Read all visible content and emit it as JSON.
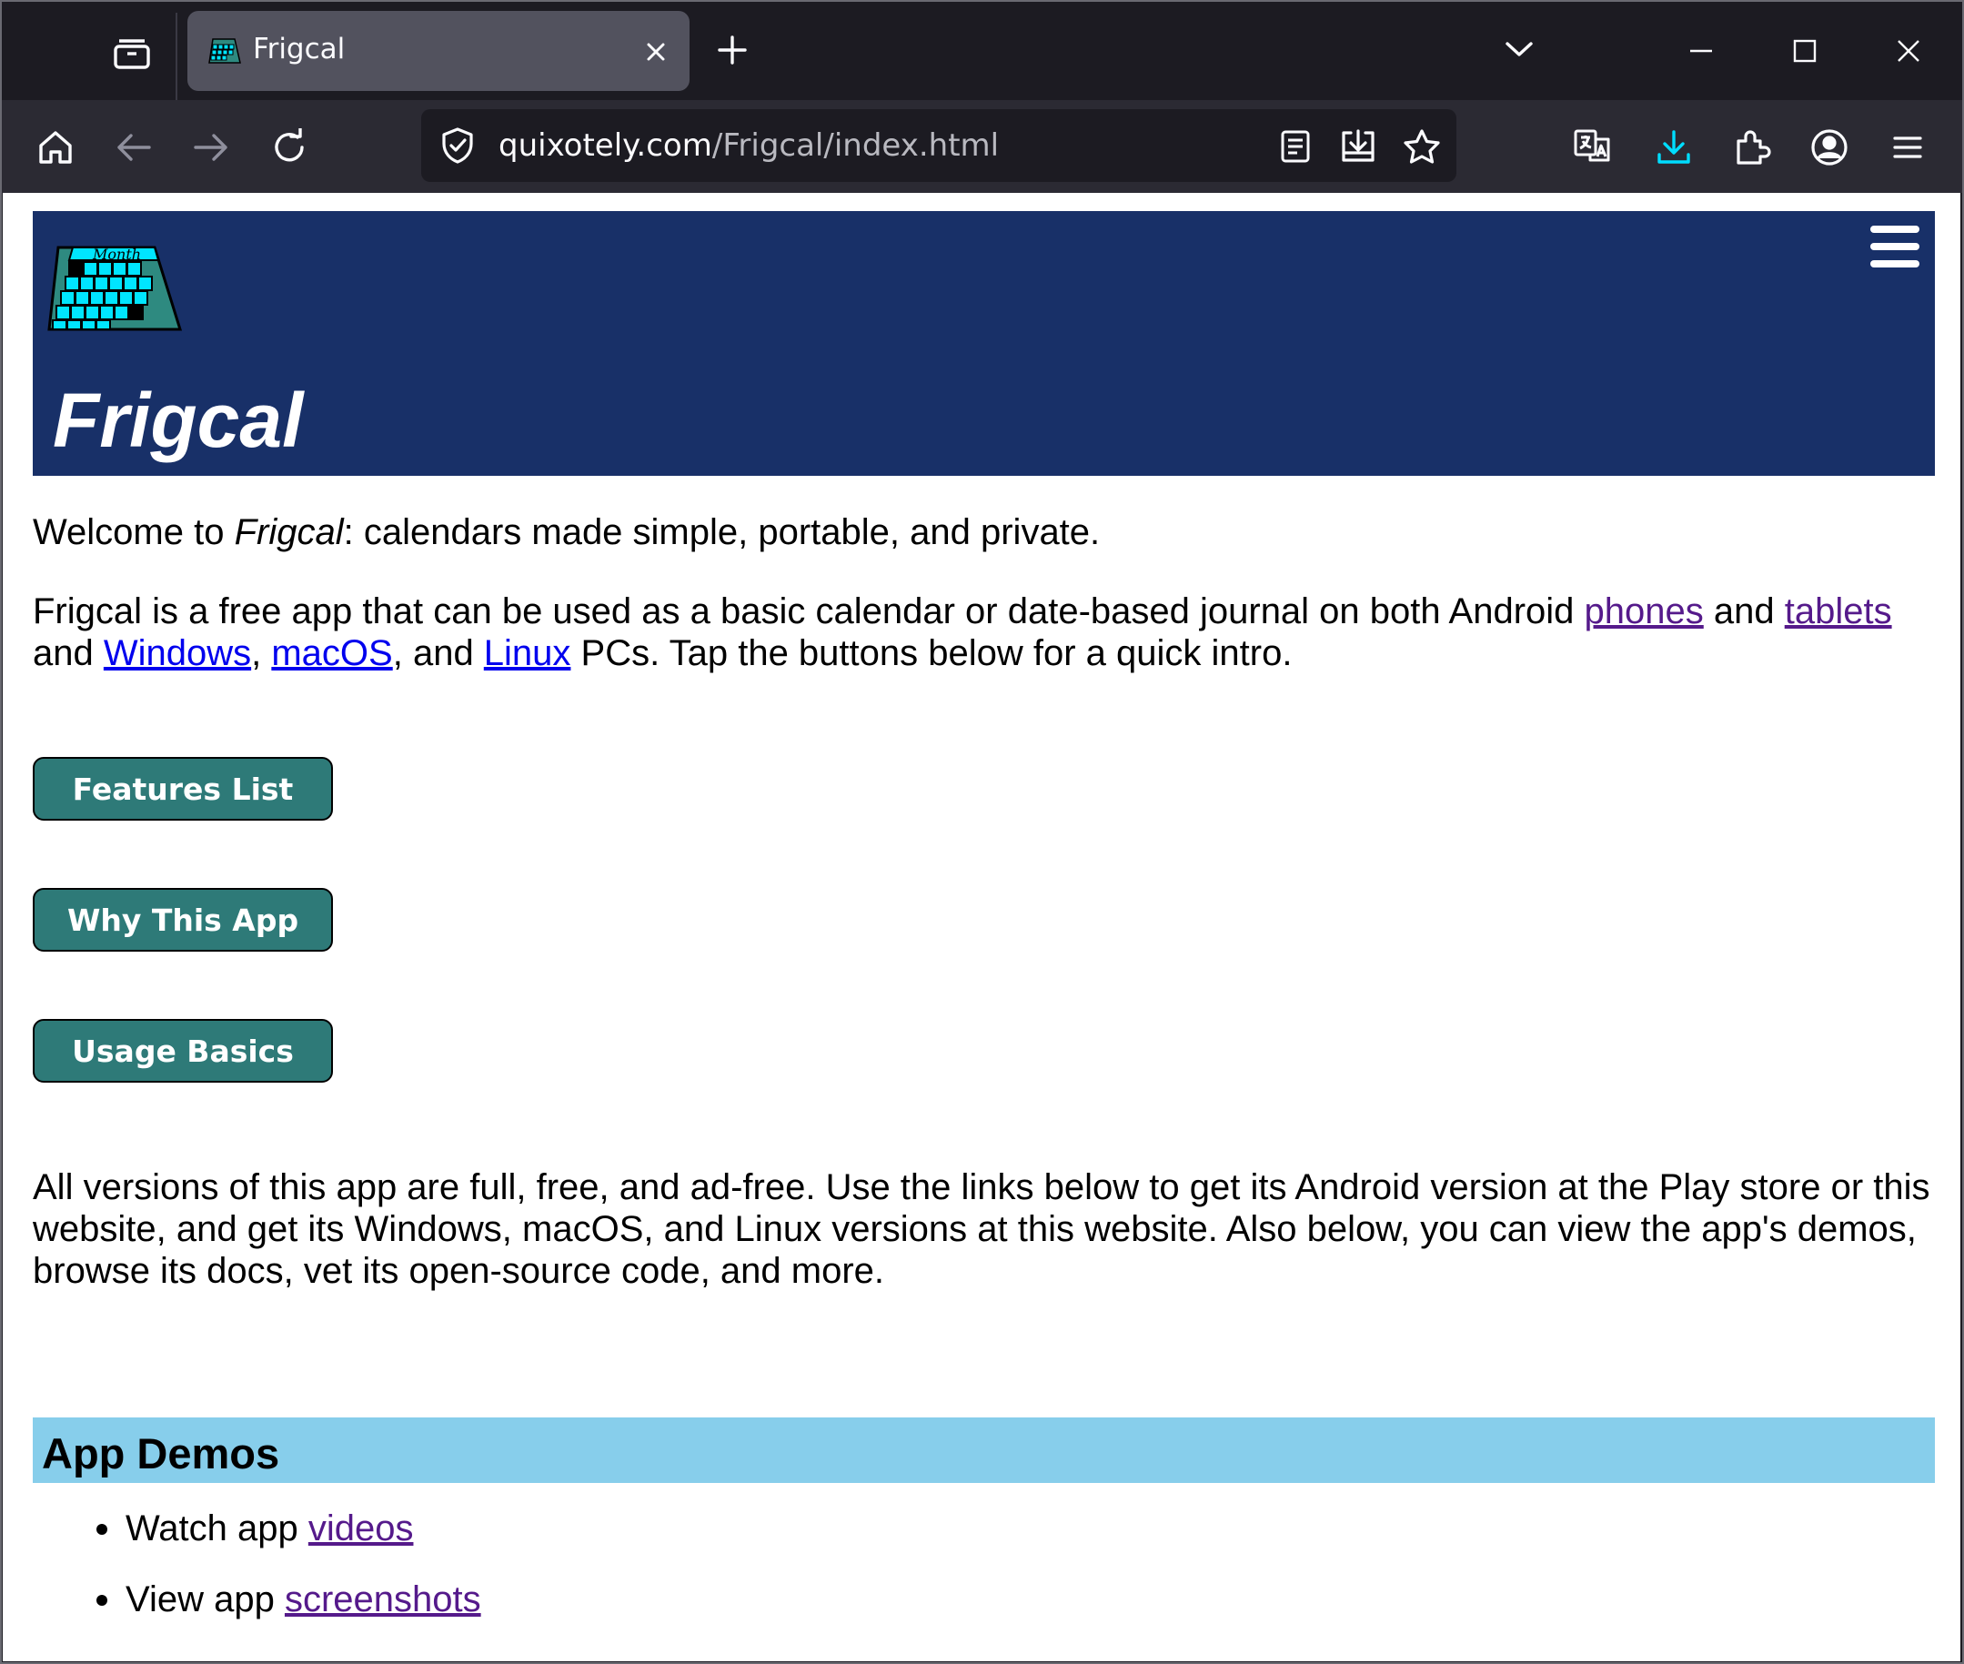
{
  "browser": {
    "tab": {
      "title": "Frigcal"
    },
    "url": {
      "domain": "quixotely.com",
      "path": "/Frigcal/index.html"
    }
  },
  "page": {
    "site_title": "Frigcal",
    "welcome": {
      "prefix": "Welcome to ",
      "app_name": "Frigcal",
      "suffix": ": calendars made simple, portable, and private."
    },
    "intro": {
      "part1": "Frigcal is a free app that can be used as a basic calendar or date-based journal on both Android ",
      "link_phones": "phones",
      "part2": " and ",
      "link_tablets": "tablets",
      "part3": " and ",
      "link_windows": "Windows",
      "part4": ", ",
      "link_macos": "macOS",
      "part5": ", and ",
      "link_linux": "Linux",
      "part6": " PCs. Tap the buttons below for a quick intro."
    },
    "buttons": {
      "features": "Features List",
      "why": "Why This App",
      "usage": "Usage Basics"
    },
    "versions_para": "All versions of this app are full, free, and ad-free. Use the links below to get its Android version at the Play store or this website, and get its Windows, macOS, and Linux versions at this website. Also below, you can view the app's demos, browse its docs, vet its open-source code, and more.",
    "demos": {
      "title": "App Demos",
      "items": [
        {
          "prefix": "Watch app ",
          "link": "videos"
        },
        {
          "prefix": "View app ",
          "link": "screenshots"
        }
      ]
    }
  },
  "colors": {
    "header_bg": "#183068",
    "button_bg": "#2e7a78",
    "section_bg": "#87ceeb",
    "visited_link": "#551a8b",
    "unvisited_link": "#0000ee",
    "download_accent": "#00ddff"
  },
  "icons": {
    "tab_strip": [
      "tab-manager-icon",
      "frigcal-favicon-icon",
      "close-icon",
      "plus-icon",
      "chevron-down-icon",
      "minimize-icon",
      "maximize-icon",
      "close-window-icon"
    ],
    "toolbar": [
      "home-icon",
      "back-icon",
      "forward-icon",
      "reload-icon",
      "shield-icon",
      "reader-view-icon",
      "save-page-icon",
      "star-icon",
      "translate-icon",
      "downloads-icon",
      "extensions-icon",
      "account-icon",
      "menu-icon"
    ]
  }
}
